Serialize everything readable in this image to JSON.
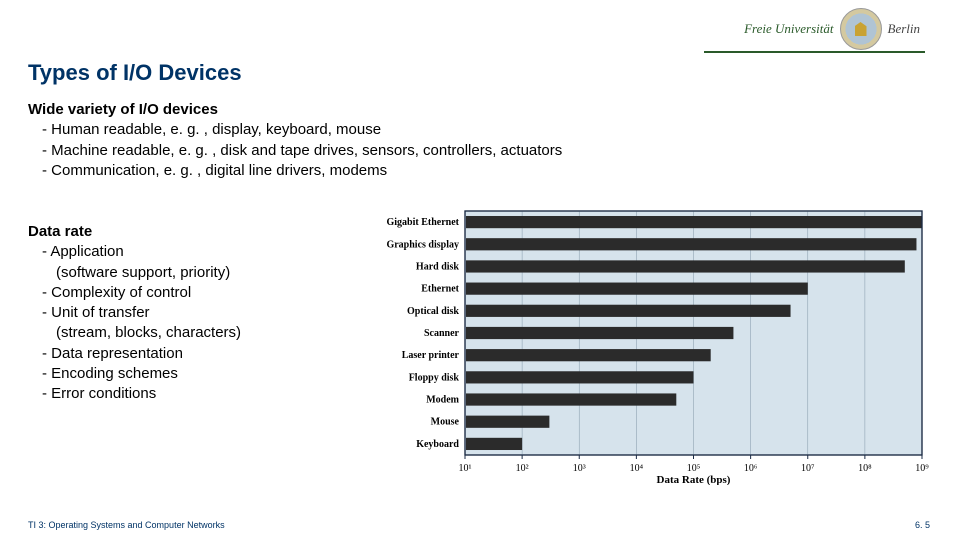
{
  "header": {
    "logo_pre": "Freie Universität",
    "logo_post": "Berlin"
  },
  "title": "Types of I/O Devices",
  "section1": {
    "lead": "Wide variety of I/O devices",
    "items": [
      "- Human readable, e. g. , display, keyboard, mouse",
      "- Machine readable, e. g. , disk and tape drives, sensors, controllers, actuators",
      "- Communication, e. g. , digital line drivers, modems"
    ]
  },
  "section2": {
    "lead": "Data rate",
    "items": [
      "- Application",
      "(software support, priority)",
      "- Complexity of control",
      "- Unit of transfer",
      "(stream, blocks, characters)",
      "- Data representation",
      "- Encoding schemes",
      "- Error conditions"
    ],
    "subindent_indices": [
      1,
      4
    ]
  },
  "chart_data": {
    "type": "bar",
    "orientation": "horizontal",
    "xlabel": "Data Rate (bps)",
    "xscale": "log",
    "xlim": [
      10,
      1000000000
    ],
    "x_ticks": [
      10,
      100,
      1000,
      10000,
      100000,
      1000000,
      10000000,
      100000000,
      1000000000
    ],
    "x_tick_labels": [
      "10¹",
      "10²",
      "10³",
      "10⁴",
      "10⁵",
      "10⁶",
      "10⁷",
      "10⁸",
      "10⁹"
    ],
    "categories": [
      "Gigabit Ethernet",
      "Graphics display",
      "Hard disk",
      "Ethernet",
      "Optical disk",
      "Scanner",
      "Laser printer",
      "Floppy disk",
      "Modem",
      "Mouse",
      "Keyboard"
    ],
    "values": [
      1000000000,
      800000000,
      500000000,
      10000000,
      5000000,
      500000,
      200000,
      100000,
      50000,
      300,
      100
    ],
    "bar_color": "#2b2b2b",
    "background": "#d6e3ec",
    "grid": true
  },
  "footer": {
    "left": "TI 3: Operating Systems and Computer Networks",
    "right": "6. 5"
  }
}
